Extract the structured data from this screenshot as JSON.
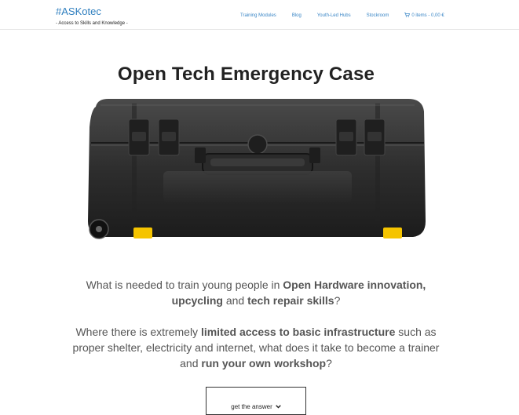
{
  "header": {
    "brand": "#ASKotec",
    "tagline": "- Access to Skills and Knowledge -",
    "nav": [
      {
        "label": "Training Modules"
      },
      {
        "label": "Blog"
      },
      {
        "label": "Youth-Led Hubs"
      },
      {
        "label": "Stockroom"
      }
    ],
    "cart": {
      "label": "0 items - 0,00 €",
      "icon": "shopping-cart-icon"
    }
  },
  "hero": {
    "title": "Open Tech Emergency Case",
    "image": "emergency-case-photo"
  },
  "intro": {
    "p1": [
      {
        "text": "What is needed to train young people in ",
        "bold": false
      },
      {
        "text": "Open Hardware innovation, upcycling",
        "bold": true
      },
      {
        "text": " and ",
        "bold": false
      },
      {
        "text": "tech repair skills",
        "bold": true
      },
      {
        "text": "?",
        "bold": false
      }
    ],
    "p2": [
      {
        "text": "Where there is extremely ",
        "bold": false
      },
      {
        "text": "limited access to basic infrastructure",
        "bold": true
      },
      {
        "text": " such as proper shelter, electricity and internet, what does it take to become a trainer and ",
        "bold": false
      },
      {
        "text": "run your own workshop",
        "bold": true
      },
      {
        "text": "?",
        "bold": false
      }
    ]
  },
  "cta": {
    "label": "get the answer",
    "icon": "chevron-down-icon"
  },
  "colors": {
    "link": "#3a86c6",
    "brand": "#2f7fbf",
    "text": "#555555",
    "accent_latch": "#f5c400"
  }
}
